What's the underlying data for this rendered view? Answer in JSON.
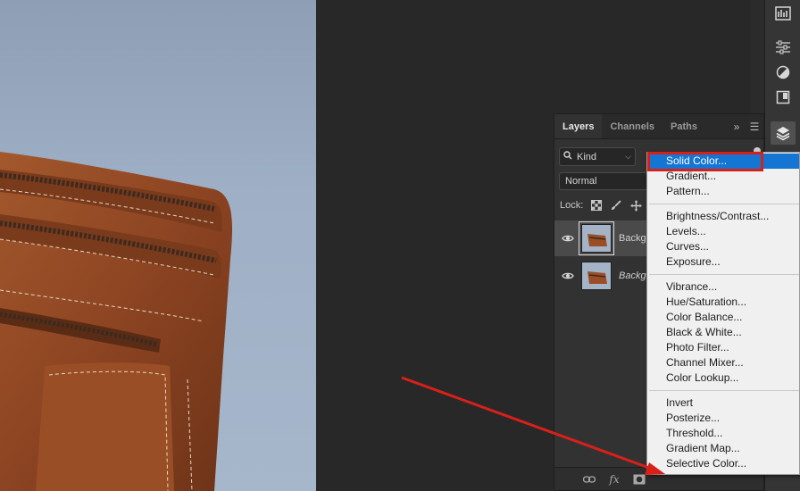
{
  "layers_panel": {
    "tabs": [
      {
        "label": "Layers",
        "active": true
      },
      {
        "label": "Channels",
        "active": false
      },
      {
        "label": "Paths",
        "active": false
      }
    ],
    "filter_value": "Kind",
    "blend_mode": "Normal",
    "lock_label": "Lock:",
    "layers": [
      {
        "name": "Backg",
        "selected": true,
        "visible": true
      },
      {
        "name": "Backg",
        "selected": false,
        "visible": true,
        "italic": true
      }
    ],
    "footer_icons": [
      "link-icon",
      "fx-icon",
      "mask-icon",
      "adjustment-icon",
      "group-icon",
      "new-layer-icon",
      "trash-icon"
    ]
  },
  "adjustment_menu": {
    "groups": [
      [
        "Solid Color...",
        "Gradient...",
        "Pattern..."
      ],
      [
        "Brightness/Contrast...",
        "Levels...",
        "Curves...",
        "Exposure..."
      ],
      [
        "Vibrance...",
        "Hue/Saturation...",
        "Color Balance...",
        "Black & White...",
        "Photo Filter...",
        "Channel Mixer...",
        "Color Lookup..."
      ],
      [
        "Invert",
        "Posterize...",
        "Threshold...",
        "Gradient Map...",
        "Selective Color..."
      ]
    ],
    "highlighted": "Solid Color..."
  },
  "right_toolbar": {
    "icons": [
      "histogram-icon",
      "adjustments-icon",
      "styles-icon",
      "libraries-icon",
      "layers-icon"
    ]
  },
  "colors": {
    "accent_highlight": "#1475d2",
    "annotation_red": "#d8201b",
    "panel_bg": "#323232"
  }
}
